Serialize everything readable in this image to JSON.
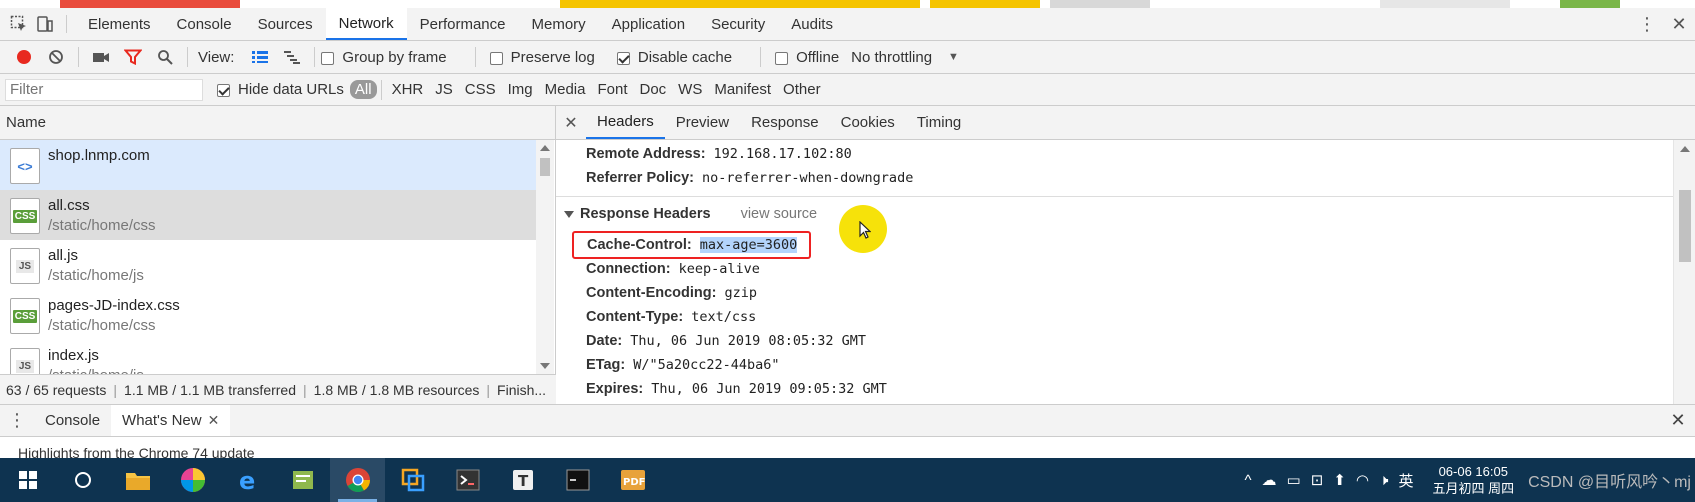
{
  "devtools_tabs": [
    "Elements",
    "Console",
    "Sources",
    "Network",
    "Performance",
    "Memory",
    "Application",
    "Security",
    "Audits"
  ],
  "active_tab": "Network",
  "toolbar": {
    "view_label": "View:",
    "group_by_frame": "Group by frame",
    "preserve_log": "Preserve log",
    "disable_cache": "Disable cache",
    "offline": "Offline",
    "throttling": "No throttling"
  },
  "filterbar": {
    "filter_placeholder": "Filter",
    "hide_data_urls": "Hide data URLs",
    "types": [
      "All",
      "XHR",
      "JS",
      "CSS",
      "Img",
      "Media",
      "Font",
      "Doc",
      "WS",
      "Manifest",
      "Other"
    ]
  },
  "name_header": "Name",
  "requests": [
    {
      "name": "shop.lnmp.com",
      "path": "",
      "type": "html"
    },
    {
      "name": "all.css",
      "path": "/static/home/css",
      "type": "css"
    },
    {
      "name": "all.js",
      "path": "/static/home/js",
      "type": "js"
    },
    {
      "name": "pages-JD-index.css",
      "path": "/static/home/css",
      "type": "css"
    },
    {
      "name": "index.js",
      "path": "/static/home/js",
      "type": "js"
    }
  ],
  "status": {
    "requests": "63 / 65 requests",
    "transferred": "1.1 MB / 1.1 MB transferred",
    "resources": "1.8 MB / 1.8 MB resources",
    "finish": "Finish..."
  },
  "detail_tabs": [
    "Headers",
    "Preview",
    "Response",
    "Cookies",
    "Timing"
  ],
  "general": [
    {
      "key": "Remote Address:",
      "value": "192.168.17.102:80"
    },
    {
      "key": "Referrer Policy:",
      "value": "no-referrer-when-downgrade"
    }
  ],
  "response_headers": {
    "title": "Response Headers",
    "view_source": "view source",
    "highlight": {
      "key": "Cache-Control:",
      "value": "max-age=3600"
    },
    "items": [
      {
        "key": "Connection:",
        "value": "keep-alive"
      },
      {
        "key": "Content-Encoding:",
        "value": "gzip"
      },
      {
        "key": "Content-Type:",
        "value": "text/css"
      },
      {
        "key": "Date:",
        "value": "Thu, 06 Jun 2019 08:05:32 GMT"
      },
      {
        "key": "ETag:",
        "value": "W/\"5a20cc22-44ba6\""
      },
      {
        "key": "Expires:",
        "value": "Thu, 06 Jun 2019 09:05:32 GMT"
      }
    ]
  },
  "drawer": {
    "tabs": [
      "Console",
      "What's New"
    ],
    "content": "Highlights from the Chrome 74 update"
  },
  "taskbar": {
    "tray_text": "英",
    "clock_time": "06-06 16:05",
    "clock_date": "五月初四 周四",
    "watermark": "CSDN @目听风吟丶mj"
  }
}
